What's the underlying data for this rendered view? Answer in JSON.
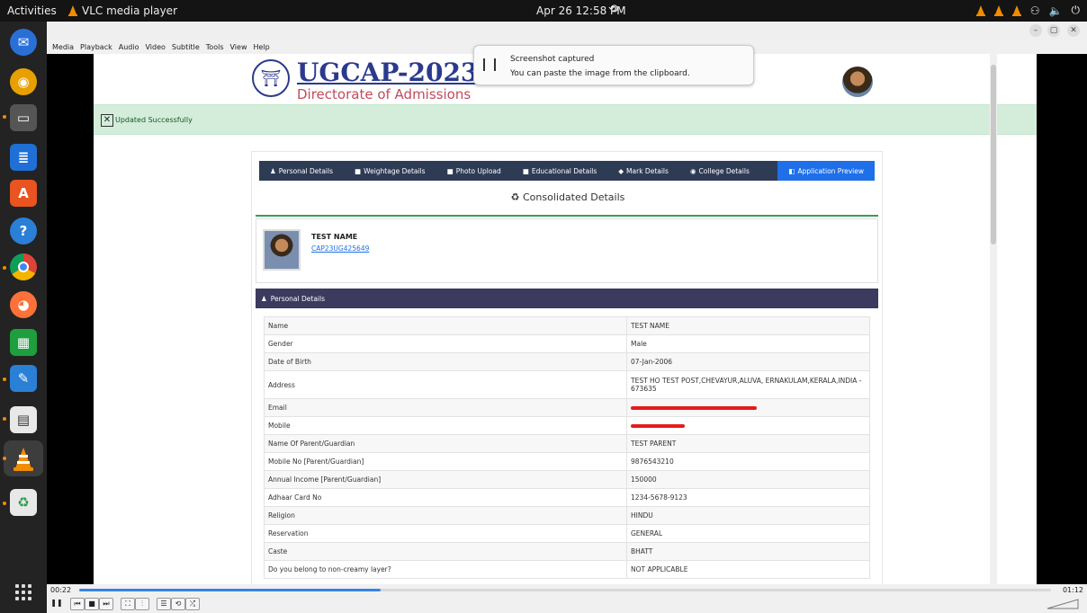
{
  "topbar": {
    "activities": "Activities",
    "app_name": "VLC media player",
    "datetime": "Apr 26  12:58 PM"
  },
  "vlc": {
    "menu": [
      "Media",
      "Playback",
      "Audio",
      "Video",
      "Subtitle",
      "Tools",
      "View",
      "Help"
    ],
    "time_elapsed": "00:22",
    "time_total": "01:12",
    "progress_fraction": 0.31
  },
  "notification": {
    "title": "Screenshot captured",
    "body": "You can paste the image from the clipboard."
  },
  "site": {
    "title": "UGCAP-2023",
    "subtitle": "Directorate of Admissions",
    "alert": "Updated Successfully",
    "tabs": [
      "Personal Details",
      "Weightage Details",
      "Photo Upload",
      "Educational Details",
      "Mark Details",
      "College Details",
      "Application Preview"
    ],
    "heading": "Consolidated Details",
    "student_name": "TEST NAME",
    "application_id": "CAP23UG425649",
    "section_title": "Personal Details",
    "details": [
      {
        "label": "Name",
        "value": "TEST NAME"
      },
      {
        "label": "Gender",
        "value": "Male"
      },
      {
        "label": "Date of Birth",
        "value": "07-Jan-2006"
      },
      {
        "label": "Address",
        "value": "TEST HO TEST POST,CHEVAYUR,ALUVA, ERNAKULAM,KERALA,INDIA - 673635"
      },
      {
        "label": "Email",
        "value": ""
      },
      {
        "label": "Mobile",
        "value": ""
      },
      {
        "label": "Name Of Parent/Guardian",
        "value": "TEST PARENT"
      },
      {
        "label": "Mobile No [Parent/Guardian]",
        "value": "9876543210"
      },
      {
        "label": "Annual Income [Parent/Guardian]",
        "value": "150000"
      },
      {
        "label": "Adhaar Card No",
        "value": "1234-5678-9123"
      },
      {
        "label": "Religion",
        "value": "HINDU"
      },
      {
        "label": "Reservation",
        "value": "GENERAL"
      },
      {
        "label": "Caste",
        "value": "BHATT"
      },
      {
        "label": "Do you belong to non-creamy layer?",
        "value": "NOT APPLICABLE"
      }
    ]
  }
}
